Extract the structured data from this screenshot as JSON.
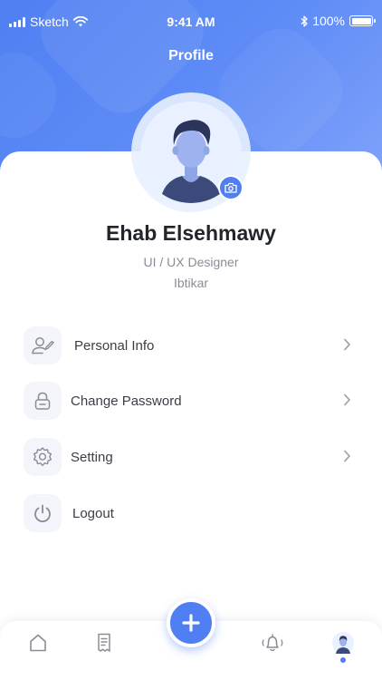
{
  "status_bar": {
    "carrier": "Sketch",
    "time": "9:41 AM",
    "battery": "100%",
    "battery_level": 1.0
  },
  "header": {
    "title": "Profile"
  },
  "profile": {
    "name": "Ehab Elsehmawy",
    "role": "UI / UX Designer",
    "company": "Ibtikar"
  },
  "menu": [
    {
      "label": "Personal Info",
      "icon": "user-edit-icon",
      "has_chevron": true
    },
    {
      "label": "Change Password",
      "icon": "lock-icon",
      "has_chevron": true
    },
    {
      "label": "Setting",
      "icon": "gear-icon",
      "has_chevron": true
    },
    {
      "label": "Logout",
      "icon": "power-icon",
      "has_chevron": false
    }
  ],
  "tabbar": {
    "items": [
      "home-icon",
      "receipt-icon",
      "add-icon",
      "bell-icon",
      "profile-avatar-icon"
    ],
    "active": "profile-avatar-icon"
  },
  "colors": {
    "primary": "#4f7ff2",
    "icon_bg": "#f4f5fb",
    "text_dark": "#22252b",
    "text_muted": "#8a8d96"
  }
}
